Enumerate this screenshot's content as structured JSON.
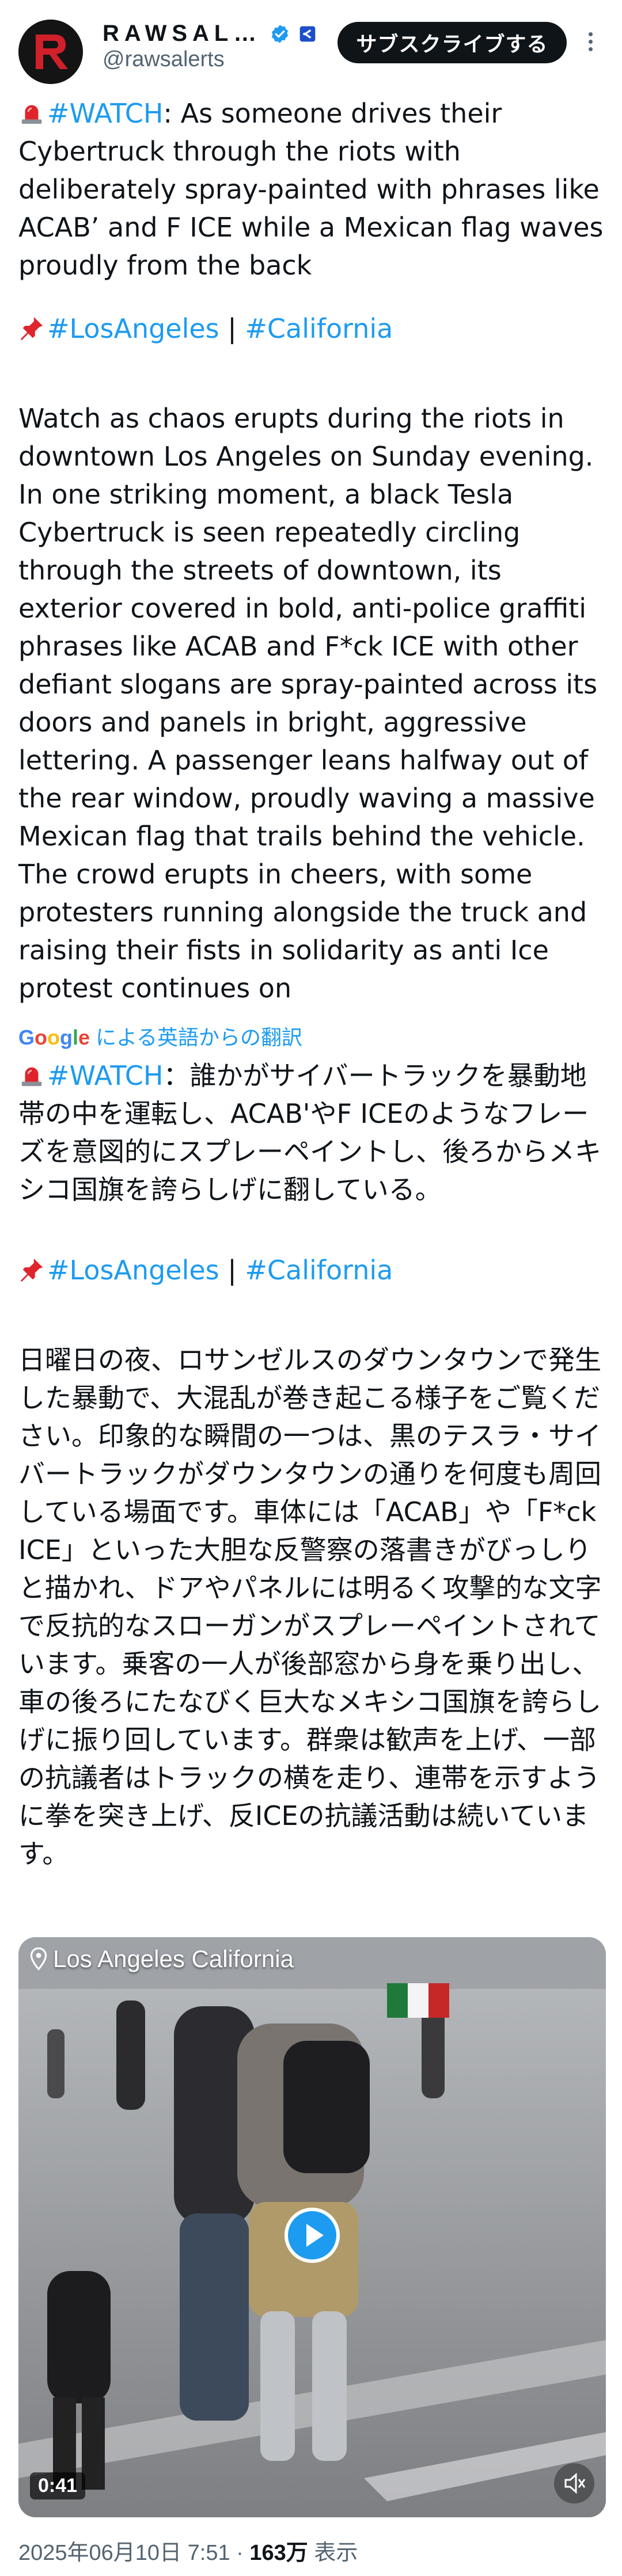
{
  "header": {
    "display_name": "RAWSAL…",
    "handle": "@rawsalerts",
    "subscribe_label": "サブスクライブする"
  },
  "post_en": {
    "hashtag_watch": "#WATCH",
    "intro": ": As someone drives their Cybertruck through the riots with deliberately spray-painted with phrases like ACAB’ and F ICE while a Mexican flag waves proudly from the back",
    "tag_la": "#LosAngeles",
    "sep": " | ",
    "tag_ca": "#California",
    "body": "Watch as chaos erupts during the riots in downtown Los Angeles on Sunday evening. In one striking moment, a black Tesla Cybertruck is seen repeatedly circling through the streets of downtown, its exterior covered in bold, anti-police graffiti phrases like ACAB and F*ck ICE with other defiant slogans are spray-painted across its doors and panels in bright, aggressive lettering. A passenger leans halfway out of the rear window, proudly waving a massive Mexican flag that trails behind the vehicle. The crowd erupts in cheers, with some protesters running alongside the truck and raising their fists in solidarity as anti Ice protest continues on"
  },
  "translation": {
    "google_word": "Google",
    "label": " による英語からの翻訳"
  },
  "post_ja": {
    "hashtag_watch": "#WATCH",
    "intro": "：誰かがサイバートラックを暴動地帯の中を運転し、ACAB'やF ICEのようなフレーズを意図的にスプレーペイントし、後ろからメキシコ国旗を誇らしげに翻している。",
    "tag_la": "#LosAngeles",
    "sep": " | ",
    "tag_ca": "#California",
    "body": "日曜日の夜、ロサンゼルスのダウンタウンで発生した暴動で、大混乱が巻き起こる様子をご覧ください。印象的な瞬間の一つは、黒のテスラ・サイバートラックがダウンタウンの通りを何度も周回している場面です。車体には「ACAB」や「F*ck ICE」といった大胆な反警察の落書きがびっしりと描かれ、ドアやパネルには明るく攻撃的な文字で反抗的なスローガンがスプレーペイントされています。乗客の一人が後部窓から身を乗り出し、車の後ろにたなびく巨大なメキシコ国旗を誇らしげに振り回しています。群衆は歓声を上げ、一部の抗議者はトラックの横を走り、連帯を示すように拳を突き上げ、反ICEの抗議活動は続いています。"
  },
  "video": {
    "location": "Los Angeles California",
    "duration": "0:41"
  },
  "footer": {
    "datetime": "2025年06月10日 7:51",
    "dot": " · ",
    "views_count": "163万",
    "views_label": " 表示"
  },
  "colors": {
    "accent": "#1d9bf0",
    "text": "#0f1419",
    "muted": "#536471"
  }
}
